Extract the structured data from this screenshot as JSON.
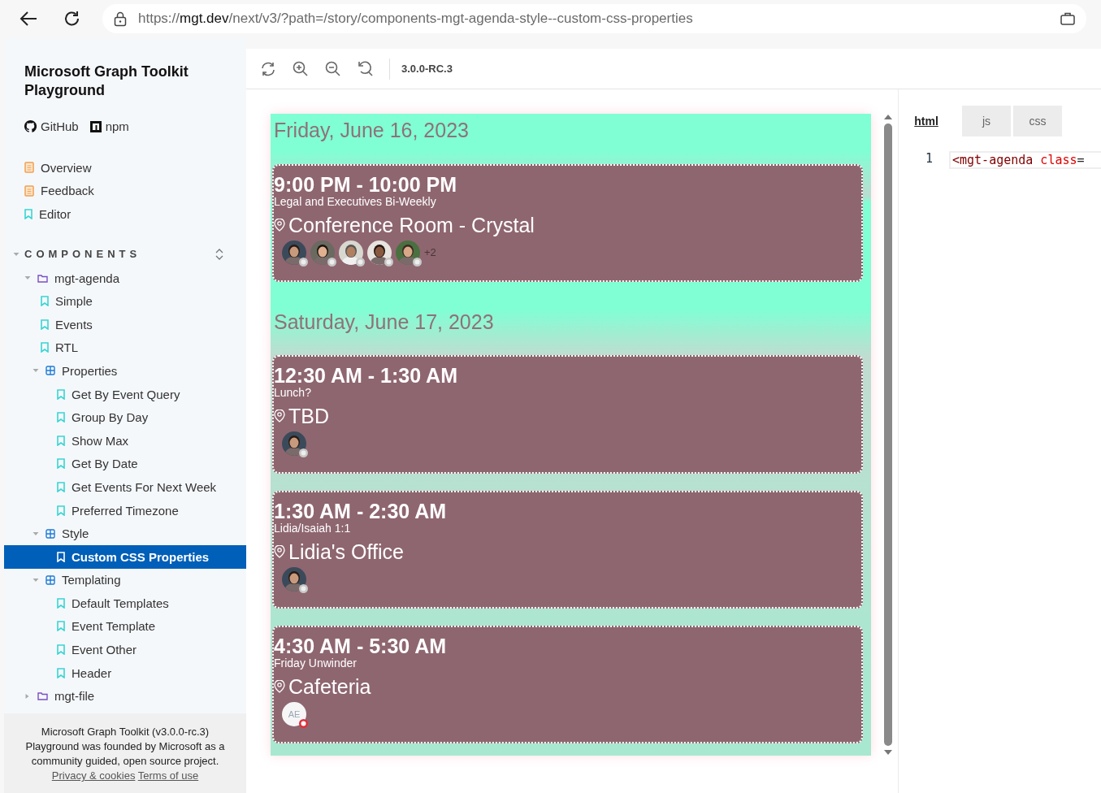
{
  "browser": {
    "url": {
      "scheme": "https://",
      "host": "mgt.dev",
      "path": "/next/v3/?path=/story/components-mgt-agenda-style--custom-css-properties"
    }
  },
  "sidebar": {
    "title": "Microsoft Graph Toolkit Playground",
    "links": [
      {
        "label": "GitHub",
        "kind": "github"
      },
      {
        "label": "npm",
        "kind": "npm"
      }
    ],
    "pages": [
      {
        "label": "Overview",
        "kind": "doc",
        "selected": false
      },
      {
        "label": "Feedback",
        "kind": "doc",
        "selected": false
      },
      {
        "label": "Editor",
        "kind": "story",
        "selected": false
      }
    ],
    "section": {
      "label": "COMPONENTS",
      "expanded": true
    },
    "tree": [
      {
        "label": "mgt-agenda",
        "kind": "folder",
        "expanded": true,
        "selected": false,
        "children": [
          {
            "label": "Simple",
            "kind": "story",
            "selected": false
          },
          {
            "label": "Events",
            "kind": "story",
            "selected": false
          },
          {
            "label": "RTL",
            "kind": "story",
            "selected": false
          },
          {
            "label": "Properties",
            "kind": "component",
            "expanded": true,
            "selected": false,
            "children": [
              {
                "label": "Get By Event Query",
                "kind": "story",
                "selected": false
              },
              {
                "label": "Group By Day",
                "kind": "story",
                "selected": false
              },
              {
                "label": "Show Max",
                "kind": "story",
                "selected": false
              },
              {
                "label": "Get By Date",
                "kind": "story",
                "selected": false
              },
              {
                "label": "Get Events For Next Week",
                "kind": "story",
                "selected": false
              },
              {
                "label": "Preferred Timezone",
                "kind": "story",
                "selected": false
              }
            ]
          },
          {
            "label": "Style",
            "kind": "component",
            "expanded": true,
            "selected": false,
            "children": [
              {
                "label": "Custom CSS Properties",
                "kind": "story",
                "selected": true
              }
            ]
          },
          {
            "label": "Templating",
            "kind": "component",
            "expanded": true,
            "selected": false,
            "children": [
              {
                "label": "Default Templates",
                "kind": "story",
                "selected": false
              },
              {
                "label": "Event Template",
                "kind": "story",
                "selected": false
              },
              {
                "label": "Event Other",
                "kind": "story",
                "selected": false
              },
              {
                "label": "Header",
                "kind": "story",
                "selected": false
              }
            ]
          }
        ]
      },
      {
        "label": "mgt-file",
        "kind": "folder",
        "expanded": false,
        "selected": false
      }
    ],
    "footer": {
      "lines": [
        "Microsoft Graph Toolkit (v3.0.0-rc.3)",
        "Playground was founded by Microsoft as a community guided, open source project."
      ],
      "links": [
        "Privacy & cookies",
        "Terms of use"
      ]
    }
  },
  "toolbar": {
    "tools": [
      {
        "kind": "refresh"
      },
      {
        "kind": "zoom-in"
      },
      {
        "kind": "zoom-out"
      },
      {
        "kind": "reset"
      }
    ],
    "version": "3.0.0-RC.3"
  },
  "agenda": {
    "days": [
      {
        "date": "Friday, June 16, 2023",
        "events": [
          {
            "time": "9:00 PM - 10:00 PM",
            "subject": "Legal and Executives Bi-Weekly",
            "location": "Conference Room - Crystal",
            "attendees": [
              {
                "kind": "photo",
                "color": "#c8c8c8"
              },
              {
                "kind": "photo",
                "color": "#c8c8c8"
              },
              {
                "kind": "photo",
                "color": "#c8c8c8"
              },
              {
                "kind": "photo",
                "color": "#c8c8c8"
              },
              {
                "kind": "photo",
                "color": "#c8c8c8"
              }
            ],
            "more": "+2"
          }
        ]
      },
      {
        "date": "Saturday, June 17, 2023",
        "events": [
          {
            "time": "12:30 AM - 1:30 AM",
            "subject": "Lunch?",
            "location": "TBD",
            "attendees": [
              {
                "kind": "photo",
                "color": "#c8c8c8"
              }
            ]
          },
          {
            "time": "1:30 AM - 2:30 AM",
            "subject": "Lidia/Isaiah 1:1",
            "location": "Lidia's Office",
            "attendees": [
              {
                "kind": "photo",
                "color": "#c8c8c8"
              }
            ]
          },
          {
            "time": "4:30 AM - 5:30 AM",
            "subject": "Friday Unwinder",
            "location": "Cafeteria",
            "attendees": [
              {
                "kind": "initials",
                "initials": "AE",
                "color": "#e0303a"
              }
            ]
          }
        ]
      }
    ]
  },
  "code": {
    "tabs": [
      {
        "label": "html",
        "selected": true
      },
      {
        "label": "js",
        "selected": false
      },
      {
        "label": "css",
        "selected": false
      }
    ],
    "lines": [
      {
        "number": "1",
        "tokens": [
          {
            "text": "<mgt-agenda",
            "kind": "tag"
          },
          {
            "text": " class",
            "kind": "attr"
          },
          {
            "text": "=",
            "kind": "punct"
          }
        ]
      }
    ]
  }
}
